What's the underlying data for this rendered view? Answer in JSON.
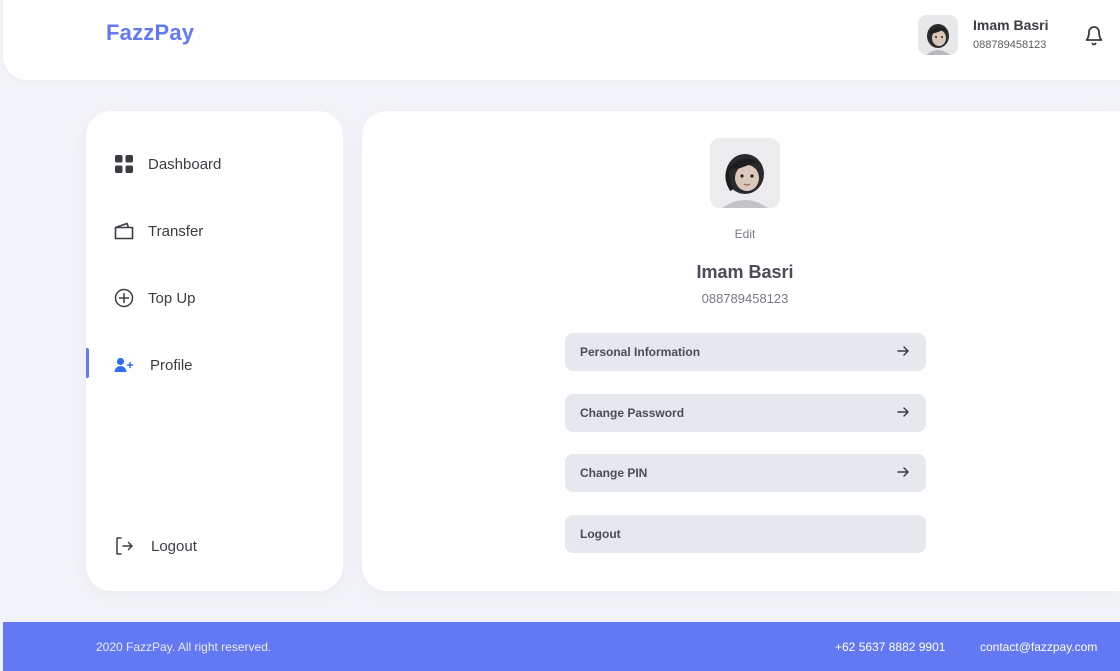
{
  "header": {
    "brand": "FazzPay",
    "user_name": "Imam Basri",
    "user_phone": "088789458123",
    "notification_icon": "bell-icon"
  },
  "sidebar": {
    "items": [
      {
        "label": "Dashboard",
        "icon": "grid-icon"
      },
      {
        "label": "Transfer",
        "icon": "wallet-icon"
      },
      {
        "label": "Top Up",
        "icon": "plus-circle-icon"
      },
      {
        "label": "Profile",
        "icon": "user-add-icon",
        "active": true
      }
    ],
    "logout": {
      "label": "Logout",
      "icon": "logout-icon"
    }
  },
  "profile": {
    "edit_label": "Edit",
    "name": "Imam Basri",
    "phone": "088789458123",
    "menu": [
      {
        "label": "Personal Information",
        "icon": "arrow-right-icon"
      },
      {
        "label": "Change Password",
        "icon": "arrow-right-icon"
      },
      {
        "label": "Change PIN",
        "icon": "arrow-right-icon"
      },
      {
        "label": "Logout"
      }
    ]
  },
  "footer": {
    "copyright": "2020 FazzPay. All right reserved.",
    "phone": "+62 5637 8882 9901",
    "email": "contact@fazzpay.com"
  },
  "colors": {
    "primary": "#6379f4",
    "button_bg": "#e5e8ed",
    "page_bg": "#f2f4f9"
  }
}
